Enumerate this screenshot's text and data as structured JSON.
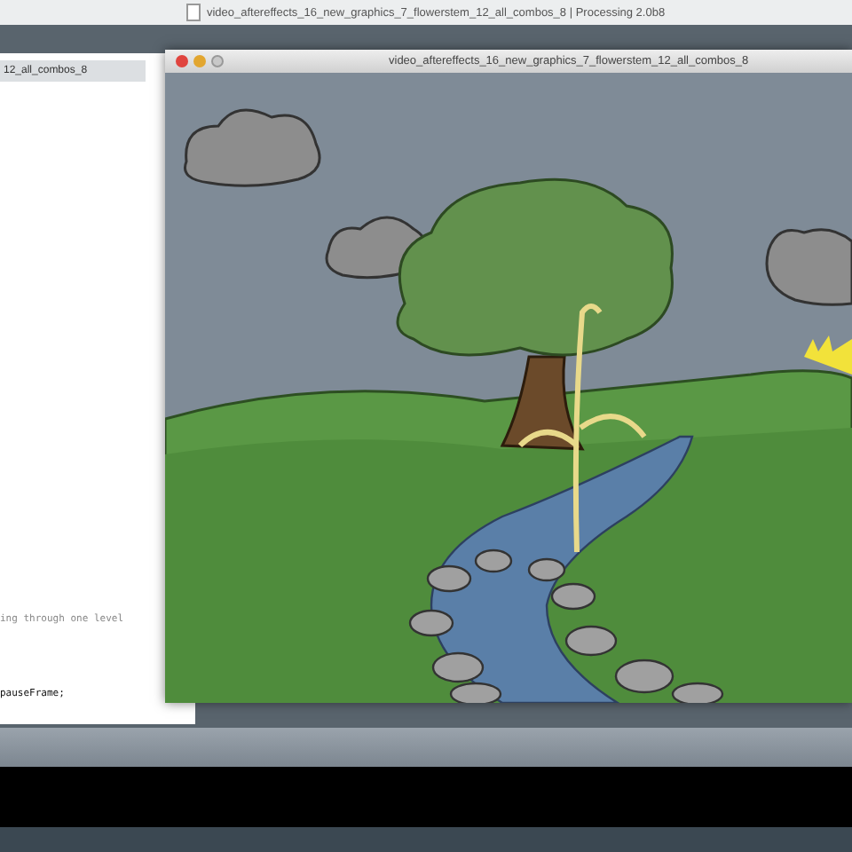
{
  "ide_window": {
    "title": "video_aftereffects_16_new_graphics_7_flowerstem_12_all_combos_8 | Processing 2.0b8",
    "tab": "12_all_combos_8",
    "code_lines": [
      {
        "kind": "comment",
        "text": "ing through one level"
      },
      {
        "kind": "code",
        "text": "pauseFrame;"
      }
    ]
  },
  "sketch_window": {
    "title": "video_aftereffects_16_new_graphics_7_flowerstem_12_all_combos_8"
  }
}
